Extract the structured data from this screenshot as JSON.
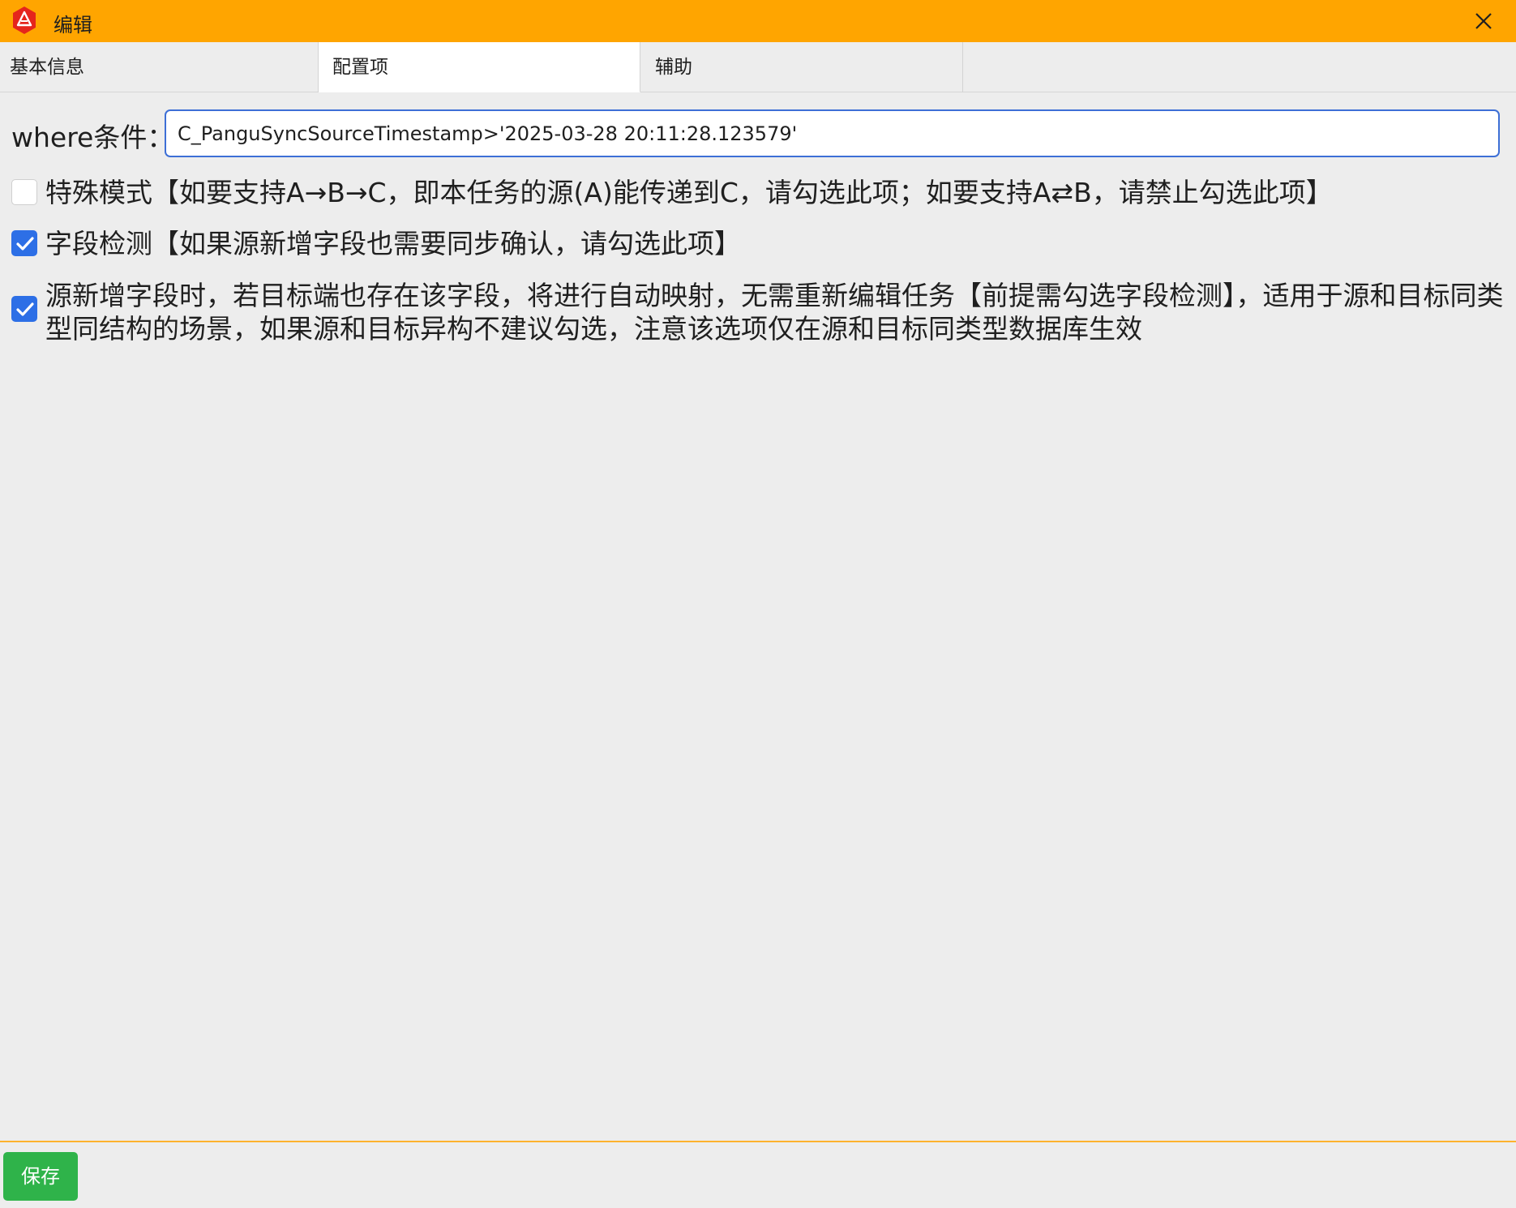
{
  "window": {
    "title": "编辑",
    "accent_color": "#ffa500"
  },
  "tabs": [
    {
      "label": "基本信息",
      "active": false
    },
    {
      "label": "配置项",
      "active": true
    },
    {
      "label": "辅助",
      "active": false
    }
  ],
  "config": {
    "where_label": "where条件：",
    "where_value": "C_PanguSyncSourceTimestamp>'2025-03-28 20:11:28.123579'",
    "options": [
      {
        "checked": false,
        "label": "特殊模式【如要支持A→B→C，即本任务的源(A)能传递到C，请勾选此项；如要支持A⇄B，请禁止勾选此项】"
      },
      {
        "checked": true,
        "label": "字段检测【如果源新增字段也需要同步确认，请勾选此项】"
      },
      {
        "checked": true,
        "label": "源新增字段时，若目标端也存在该字段，将进行自动映射，无需重新编辑任务【前提需勾选字段检测】，适用于源和目标同类型同结构的场景，如果源和目标异构不建议勾选，注意该选项仅在源和目标同类型数据库生效"
      }
    ]
  },
  "footer": {
    "save_label": "保存",
    "save_color": "#2fb34a"
  },
  "icons": {
    "app": "app-logo-icon",
    "close": "close-icon",
    "check": "checkmark-icon"
  }
}
